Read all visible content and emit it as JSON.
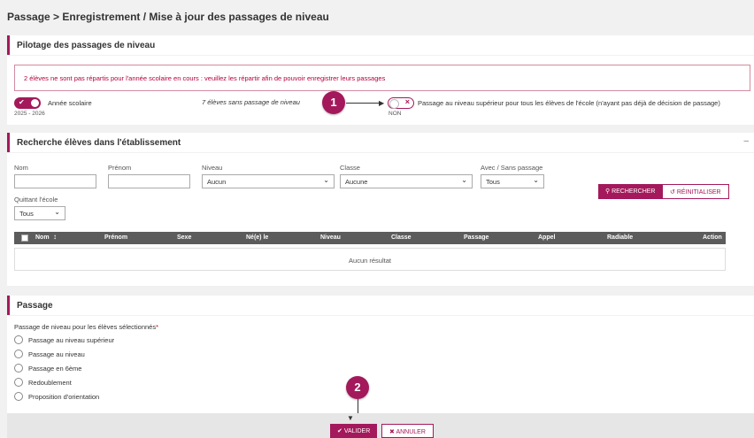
{
  "page": {
    "title": "Passage > Enregistrement / Mise à jour des passages de niveau"
  },
  "pilotage": {
    "title": "Pilotage des passages de niveau",
    "alert": "2 élèves ne sont pas répartis pour l'année scolaire en cours : veuillez les répartir afin de pouvoir enregistrer leurs passages",
    "annee_label": "Année scolaire",
    "annee_value": "2025 - 2026",
    "sans_passage": "7 élèves sans passage de niveau",
    "badge1": "1",
    "toggle_label": "Passage au niveau supérieur pour tous les élèves de l'école (n'ayant pas déjà de décision de passage)",
    "toggle_state": "NON"
  },
  "recherche": {
    "title": "Recherche élèves dans l'établissement",
    "collapse": "–",
    "nom_label": "Nom",
    "prenom_label": "Prénom",
    "niveau_label": "Niveau",
    "niveau_value": "Aucun",
    "classe_label": "Classe",
    "classe_value": "Aucune",
    "avec_label": "Avec / Sans passage",
    "avec_value": "Tous",
    "quittant_label": "Quittant l'école",
    "quittant_value": "Tous",
    "rechercher": "RECHERCHER",
    "reinitialiser": "RÉINITIALISER",
    "columns": [
      "Nom",
      "Prénom",
      "Sexe",
      "Né(e) le",
      "Niveau",
      "Classe",
      "Passage",
      "Appel",
      "Radiable",
      "Action"
    ],
    "empty": "Aucun résultat"
  },
  "passage": {
    "title": "Passage",
    "field_label": "Passage de niveau pour les élèves sélectionnés",
    "required": "*",
    "options": [
      "Passage au niveau supérieur",
      "Passage au niveau",
      "Passage en 6ème",
      "Redoublement",
      "Proposition d'orientation"
    ],
    "badge2": "2"
  },
  "footer": {
    "valider": "VALIDER",
    "annuler": "ANNULER"
  },
  "colors": {
    "accent": "#a3195b",
    "header": "#5c5c5c"
  }
}
